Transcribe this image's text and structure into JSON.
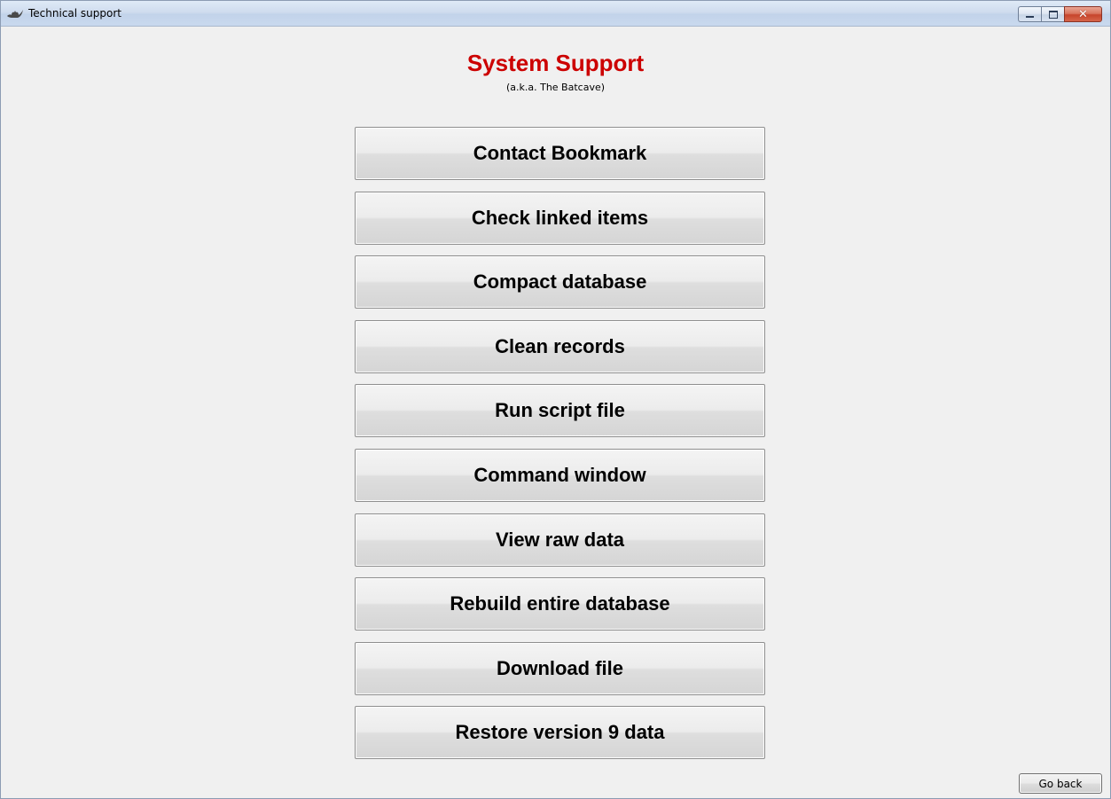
{
  "window": {
    "title": "Technical support",
    "icon": "bat-icon",
    "close_glyph": "✕"
  },
  "header": {
    "title": "System Support",
    "subtitle": "(a.k.a. The Batcave)",
    "title_color": "#cc0000"
  },
  "actions": [
    {
      "label": "Contact Bookmark"
    },
    {
      "label": "Check linked items"
    },
    {
      "label": "Compact database"
    },
    {
      "label": "Clean records"
    },
    {
      "label": "Run script file"
    },
    {
      "label": "Command window"
    },
    {
      "label": "View raw data"
    },
    {
      "label": "Rebuild entire database"
    },
    {
      "label": "Download file"
    },
    {
      "label": "Restore version 9 data"
    }
  ],
  "footer": {
    "go_back_label": "Go back"
  }
}
